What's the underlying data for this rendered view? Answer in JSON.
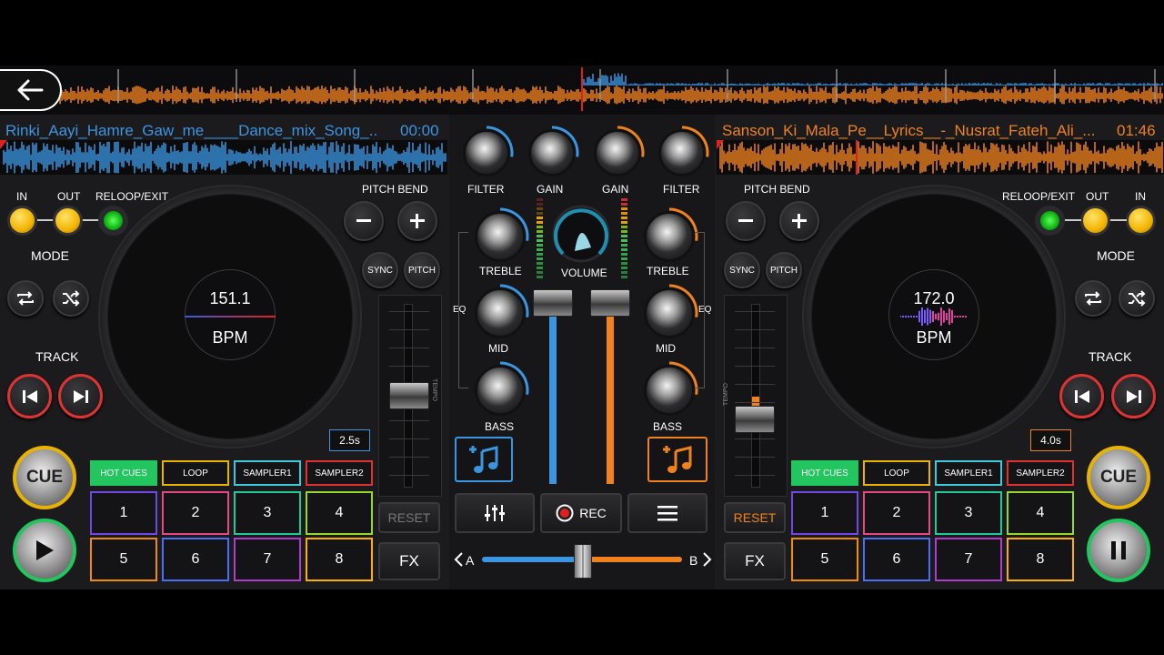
{
  "left_deck": {
    "track_title": "Rinki_Aayi_Hamre_Gaw_me____Dance_mix_Song_...",
    "time": "00:00",
    "bpm_value": "151.1",
    "bpm_label": "BPM",
    "in_label": "IN",
    "out_label": "OUT",
    "reloop_label": "RELOOP/EXIT",
    "mode_label": "MODE",
    "track_label": "TRACK",
    "pitch_bend_label": "PITCH BEND",
    "sync_label": "SYNC",
    "pitch_label": "PITCH",
    "loop_length": "2.5s",
    "reset_label": "RESET",
    "fx_label": "FX",
    "cue_label": "CUE",
    "tempo_label": "TEMPO",
    "tabs": [
      "HOT CUES",
      "LOOP",
      "SAMPLER1",
      "SAMPLER2"
    ],
    "pads": [
      "1",
      "2",
      "3",
      "4",
      "5",
      "6",
      "7",
      "8"
    ],
    "play_state": "play",
    "accent_color": "#3b95e0"
  },
  "right_deck": {
    "track_title": "Sanson_Ki_Mala_Pe__Lyrics__-_Nusrat_Fateh_Ali_...",
    "time": "01:46",
    "bpm_value": "172.0",
    "bpm_label": "BPM",
    "in_label": "IN",
    "out_label": "OUT",
    "reloop_label": "RELOOP/EXIT",
    "mode_label": "MODE",
    "track_label": "TRACK",
    "pitch_bend_label": "PITCH BEND",
    "sync_label": "SYNC",
    "pitch_label": "PITCH",
    "loop_length": "4.0s",
    "reset_label": "RESET",
    "fx_label": "FX",
    "cue_label": "CUE",
    "tempo_label": "TEMPO",
    "tabs": [
      "HOT CUES",
      "LOOP",
      "SAMPLER1",
      "SAMPLER2"
    ],
    "pads": [
      "1",
      "2",
      "3",
      "4",
      "5",
      "6",
      "7",
      "8"
    ],
    "play_state": "pause",
    "accent_color": "#f0821e"
  },
  "mixer": {
    "filter_label": "FILTER",
    "gain_label": "GAIN",
    "volume_label": "VOLUME",
    "treble_label": "TREBLE",
    "mid_label": "MID",
    "bass_label": "BASS",
    "eq_label": "EQ",
    "rec_label": "REC",
    "crossfader_a": "A",
    "crossfader_b": "B",
    "crossfader_position": 0.5
  },
  "colors": {
    "blue": "#3b95e0",
    "orange": "#f0821e",
    "green": "#22c55e"
  },
  "icons": [
    "back-arrow-icon",
    "repeat-icon",
    "shuffle-icon",
    "previous-track-icon",
    "next-track-icon",
    "play-icon",
    "pause-icon",
    "add-music-icon",
    "equalizer-sliders-icon",
    "record-icon",
    "menu-icon",
    "chevron-left-icon",
    "chevron-right-icon",
    "minus-icon",
    "plus-icon"
  ]
}
